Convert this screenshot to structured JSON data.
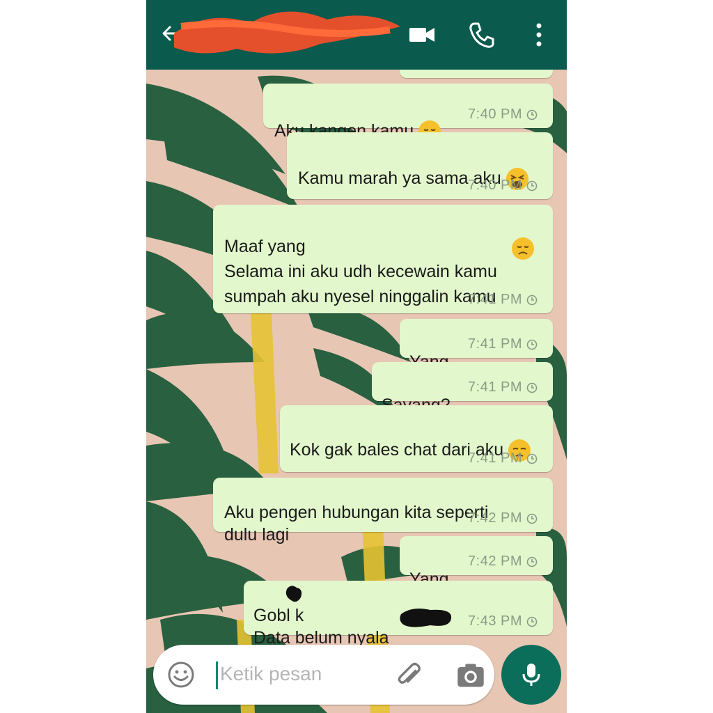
{
  "header": {
    "contact_name": "",
    "icons": [
      "back-arrow-icon",
      "video-call-icon",
      "phone-icon",
      "more-vert-icon"
    ]
  },
  "messages": [
    {
      "text": "Aku kangen kamu",
      "emoji": "disappointed-face",
      "time": "7:40 PM"
    },
    {
      "text": "Kamu marah ya sama aku",
      "emoji": "weary-face",
      "time": "7:40 PM"
    },
    {
      "text": "Maaf yang\nSelama ini aku udh kecewain kamu\nsumpah aku nyesel ninggalin kamu",
      "emoji": "disappointed-face",
      "time": "7:41 PM"
    },
    {
      "text": "Yang",
      "time": "7:41 PM"
    },
    {
      "text": "Sayang?",
      "time": "7:41 PM"
    },
    {
      "text": "Kok gak bales chat dari aku",
      "emoji": "pensive-face",
      "time": "7:41 PM"
    },
    {
      "text": "Aku pengen hubungan kita seperti\ndulu lagi",
      "time": "7:42 PM"
    },
    {
      "text": "Yang",
      "time": "7:42 PM"
    },
    {
      "text": "Gobl k\nData belum nyala",
      "time": "7:43 PM"
    }
  ],
  "input": {
    "placeholder": "Ketik pesan",
    "icons": [
      "emoji-icon",
      "attach-icon",
      "camera-icon",
      "mic-icon"
    ]
  },
  "colors": {
    "header": "#0b5a4e",
    "bubble": "#e2f7cb",
    "mic_button": "#0b6e5b",
    "wallpaper_bg": "#e8c6b4",
    "leaf": "#1f5b3a"
  }
}
